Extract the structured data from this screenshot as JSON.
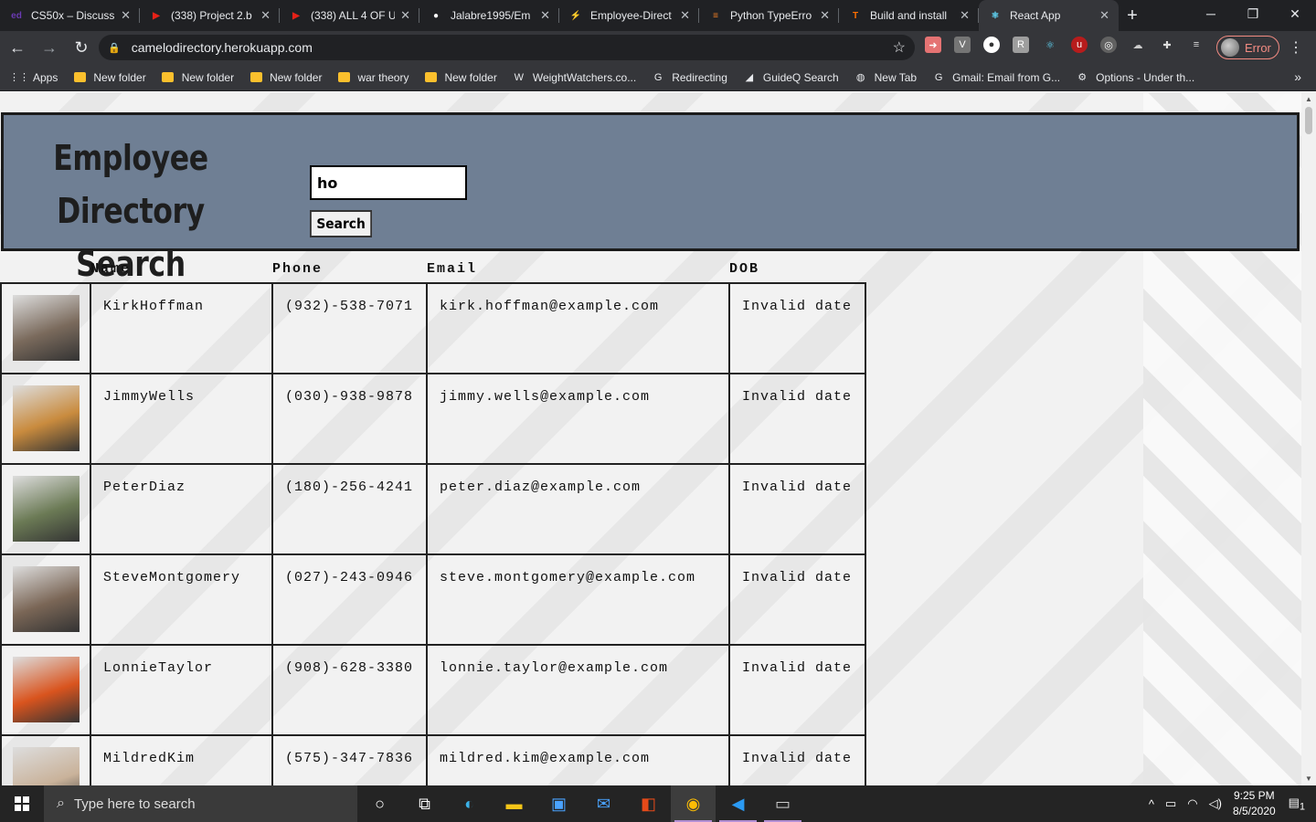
{
  "browser": {
    "tabs": [
      {
        "title": "CS50x – Discussi",
        "favicon": "ed",
        "color": "#6a3ab2"
      },
      {
        "title": "(338) Project 2.b",
        "favicon": "▶",
        "color": "#e62117"
      },
      {
        "title": "(338) ALL 4 OF U",
        "favicon": "▶",
        "color": "#e62117"
      },
      {
        "title": "Jalabre1995/Em",
        "favicon": "●",
        "color": "#ffffff"
      },
      {
        "title": "Employee-Direct",
        "favicon": "⚡",
        "color": "#f5c518"
      },
      {
        "title": "Python TypeErro",
        "favicon": "≡",
        "color": "#f48024"
      },
      {
        "title": "Build and install",
        "favicon": "T",
        "color": "#ff6f00"
      },
      {
        "title": "React App",
        "favicon": "⚛",
        "color": "#61dafb"
      }
    ],
    "url": "camelodirectory.herokuapp.com",
    "error_label": "Error",
    "bookmarks": [
      {
        "label": "Apps",
        "icon": "apps-icon"
      },
      {
        "label": "New folder",
        "icon": "folder-icon"
      },
      {
        "label": "New folder",
        "icon": "folder-icon"
      },
      {
        "label": "New folder",
        "icon": "folder-icon"
      },
      {
        "label": "war theory",
        "icon": "folder-icon"
      },
      {
        "label": "New folder",
        "icon": "folder-icon"
      },
      {
        "label": "WeightWatchers.co...",
        "icon": "ww-icon"
      },
      {
        "label": "Redirecting",
        "icon": "google-icon"
      },
      {
        "label": "GuideQ Search",
        "icon": "guideq-icon"
      },
      {
        "label": "New Tab",
        "icon": "globe-icon"
      },
      {
        "label": "Gmail: Email from G...",
        "icon": "google-icon"
      },
      {
        "label": "Options - Under th...",
        "icon": "gear-icon"
      }
    ]
  },
  "page": {
    "title_line1": "Employee Directory",
    "title_line2": "Search",
    "search": {
      "value": "ho",
      "button_label": "Search"
    },
    "columns": [
      "Name",
      "Phone",
      "Email",
      "DOB"
    ],
    "employees": [
      {
        "name": "KirkHoffman",
        "phone": "(932)-538-7071",
        "email": "kirk.hoffman@example.com",
        "dob": "Invalid date",
        "avatar_color": "#7a6a5c"
      },
      {
        "name": "JimmyWells",
        "phone": "(030)-938-9878",
        "email": "jimmy.wells@example.com",
        "dob": "Invalid date",
        "avatar_color": "#c98b3e"
      },
      {
        "name": "PeterDiaz",
        "phone": "(180)-256-4241",
        "email": "peter.diaz@example.com",
        "dob": "Invalid date",
        "avatar_color": "#6b7a55"
      },
      {
        "name": "SteveMontgomery",
        "phone": "(027)-243-0946",
        "email": "steve.montgomery@example.com",
        "dob": "Invalid date",
        "avatar_color": "#7a6656"
      },
      {
        "name": "LonnieTaylor",
        "phone": "(908)-628-3380",
        "email": "lonnie.taylor@example.com",
        "dob": "Invalid date",
        "avatar_color": "#d9541e"
      },
      {
        "name": "MildredKim",
        "phone": "(575)-347-7836",
        "email": "mildred.kim@example.com",
        "dob": "Invalid date",
        "avatar_color": "#c9b29a"
      }
    ]
  },
  "taskbar": {
    "search_placeholder": "Type here to search",
    "time": "9:25 PM",
    "date": "8/5/2020",
    "notification_count": "1"
  }
}
